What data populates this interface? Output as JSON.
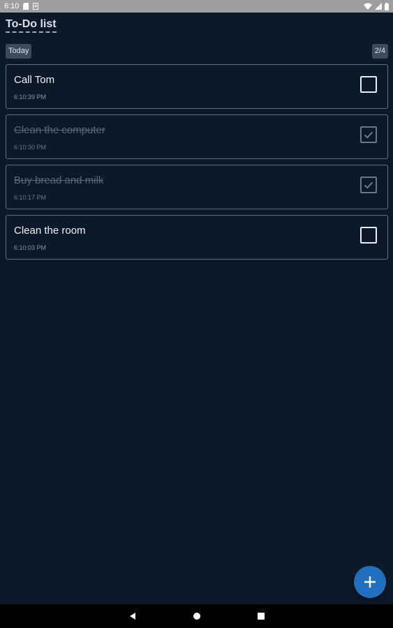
{
  "status_bar": {
    "time": "6:10",
    "icons": [
      "sd-card-icon",
      "notification-icon",
      "wifi-icon",
      "signal-icon",
      "battery-icon"
    ]
  },
  "header": {
    "title": "To-Do list"
  },
  "filter": {
    "label": "Today",
    "count": "2/4"
  },
  "tasks": [
    {
      "title": "Call Tom",
      "time": "6:10:39 PM",
      "done": false
    },
    {
      "title": "Clean the computer",
      "time": "6:10:30 PM",
      "done": true
    },
    {
      "title": "Buy bread and milk",
      "time": "6:10:17 PM",
      "done": true
    },
    {
      "title": "Clean the room",
      "time": "6:10:03 PM",
      "done": false
    }
  ],
  "fab": {
    "icon": "plus-icon"
  },
  "nav_bar": {
    "icons": [
      "back-icon",
      "home-icon",
      "recents-icon"
    ]
  },
  "colors": {
    "background": "#0b1929",
    "accent": "#1f6fbe",
    "card_border": "#5f6f80",
    "done_text": "#5a6877"
  }
}
